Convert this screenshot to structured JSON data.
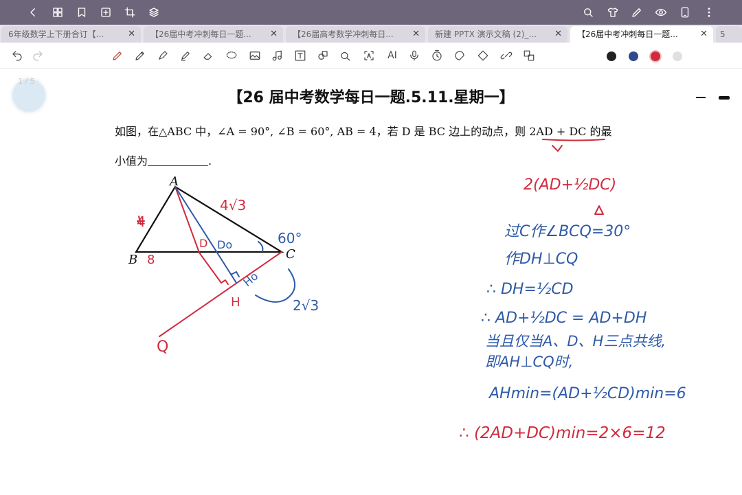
{
  "tabs": [
    {
      "label": "6年级数学上下册合订【..."
    },
    {
      "label": "【26届中考冲刺每日一题..."
    },
    {
      "label": "【26届高考数学冲刺每日..."
    },
    {
      "label": "新建 PPTX 演示文稿 (2)_..."
    },
    {
      "label": "【26届中考冲刺每日一题..."
    },
    {
      "label": "5"
    }
  ],
  "toolbar": {
    "ai_label": "AI"
  },
  "page_indicator": "1 / 5",
  "document": {
    "title": "【26 届中考数学每日一题.5.11.星期一】",
    "question_line1": "如图，在△ABC 中，∠A = 90°, ∠B = 60°, AB = 4，若 D 是 BC 边上的动点，则 2AD + DC 的最",
    "question_line2": "小值为",
    "answer_end": "."
  },
  "figure": {
    "label_A": "A",
    "label_B": "B",
    "label_C": "C",
    "mark_4": "4",
    "mark_8": "8",
    "mark_4r3": "4√3",
    "mark_60": "60°",
    "mark_D": "D",
    "mark_Do": "Do",
    "mark_Ho": "Ho",
    "mark_H": "H",
    "mark_Q": "Q",
    "mark_2r3": "2√3"
  },
  "notes": {
    "top": "2(AD+½DC)",
    "line1": "过C作∠BCQ=30°",
    "line2": "作DH⊥CQ",
    "line3": "∴ DH=½CD",
    "line4": "∴ AD+½DC = AD+DH",
    "line5": "当且仅当A、D、H三点共线,",
    "line6": "即AH⊥CQ时,",
    "line7": "AHmin=(AD+½CD)min=6",
    "line8": "∴ (2AD+DC)min=2×6=12"
  },
  "colors": {
    "topbar": "#6d6579",
    "note_blue": "#2e5aa8",
    "note_red": "#d02b3c"
  }
}
